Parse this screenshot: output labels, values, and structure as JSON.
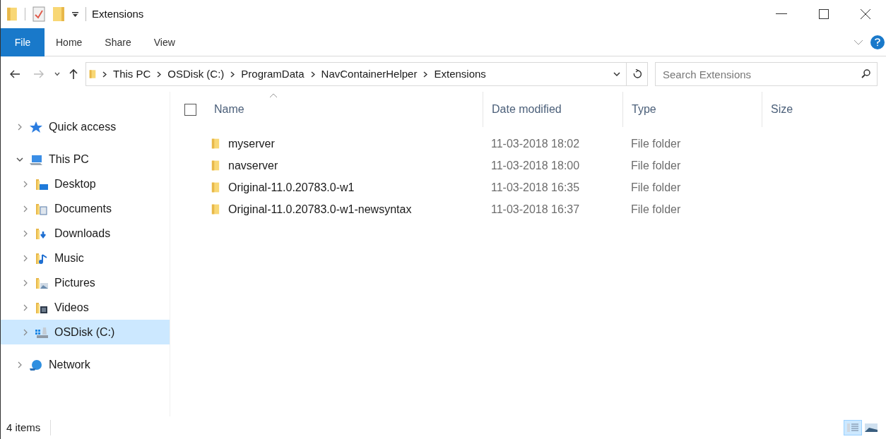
{
  "window": {
    "title": "Extensions"
  },
  "ribbon_tabs": [
    {
      "label": "File",
      "selected": true
    },
    {
      "label": "Home",
      "selected": false
    },
    {
      "label": "Share",
      "selected": false
    },
    {
      "label": "View",
      "selected": false
    }
  ],
  "breadcrumb": [
    "This PC",
    "OSDisk (C:)",
    "ProgramData",
    "NavContainerHelper",
    "Extensions"
  ],
  "search": {
    "placeholder": "Search Extensions"
  },
  "sidebar": {
    "groups": [
      {
        "items": [
          {
            "label": "Quick access",
            "kind": "star",
            "expanded": false,
            "selected": false
          }
        ]
      },
      {
        "items": [
          {
            "label": "This PC",
            "kind": "pc",
            "expanded": true,
            "selected": false,
            "children": [
              {
                "label": "Desktop",
                "kind": "desktop",
                "expanded": false,
                "selected": false
              },
              {
                "label": "Documents",
                "kind": "documents",
                "expanded": false,
                "selected": false
              },
              {
                "label": "Downloads",
                "kind": "downloads",
                "expanded": false,
                "selected": false
              },
              {
                "label": "Music",
                "kind": "music",
                "expanded": false,
                "selected": false
              },
              {
                "label": "Pictures",
                "kind": "pictures",
                "expanded": false,
                "selected": false
              },
              {
                "label": "Videos",
                "kind": "videos",
                "expanded": false,
                "selected": false
              },
              {
                "label": "OSDisk (C:)",
                "kind": "drive",
                "expanded": false,
                "selected": true
              }
            ]
          }
        ]
      },
      {
        "items": [
          {
            "label": "Network",
            "kind": "network",
            "expanded": false,
            "selected": false
          }
        ]
      }
    ]
  },
  "table": {
    "select_all_checked": false,
    "columns": [
      "Name",
      "Date modified",
      "Type",
      "Size"
    ],
    "rows": [
      {
        "name": "myserver",
        "date": "11-03-2018 18:02",
        "type": "File folder"
      },
      {
        "name": "navserver",
        "date": "11-03-2018 18:00",
        "type": "File folder"
      },
      {
        "name": "Original-11.0.20783.0-w1",
        "date": "11-03-2018 16:35",
        "type": "File folder"
      },
      {
        "name": "Original-11.0.20783.0-w1-newsyntax",
        "date": "11-03-2018 16:37",
        "type": "File folder"
      }
    ]
  },
  "status_bar": {
    "text": "4 items"
  },
  "view_buttons": [
    {
      "kind": "details",
      "selected": true
    },
    {
      "kind": "thumbnails",
      "selected": false
    }
  ]
}
